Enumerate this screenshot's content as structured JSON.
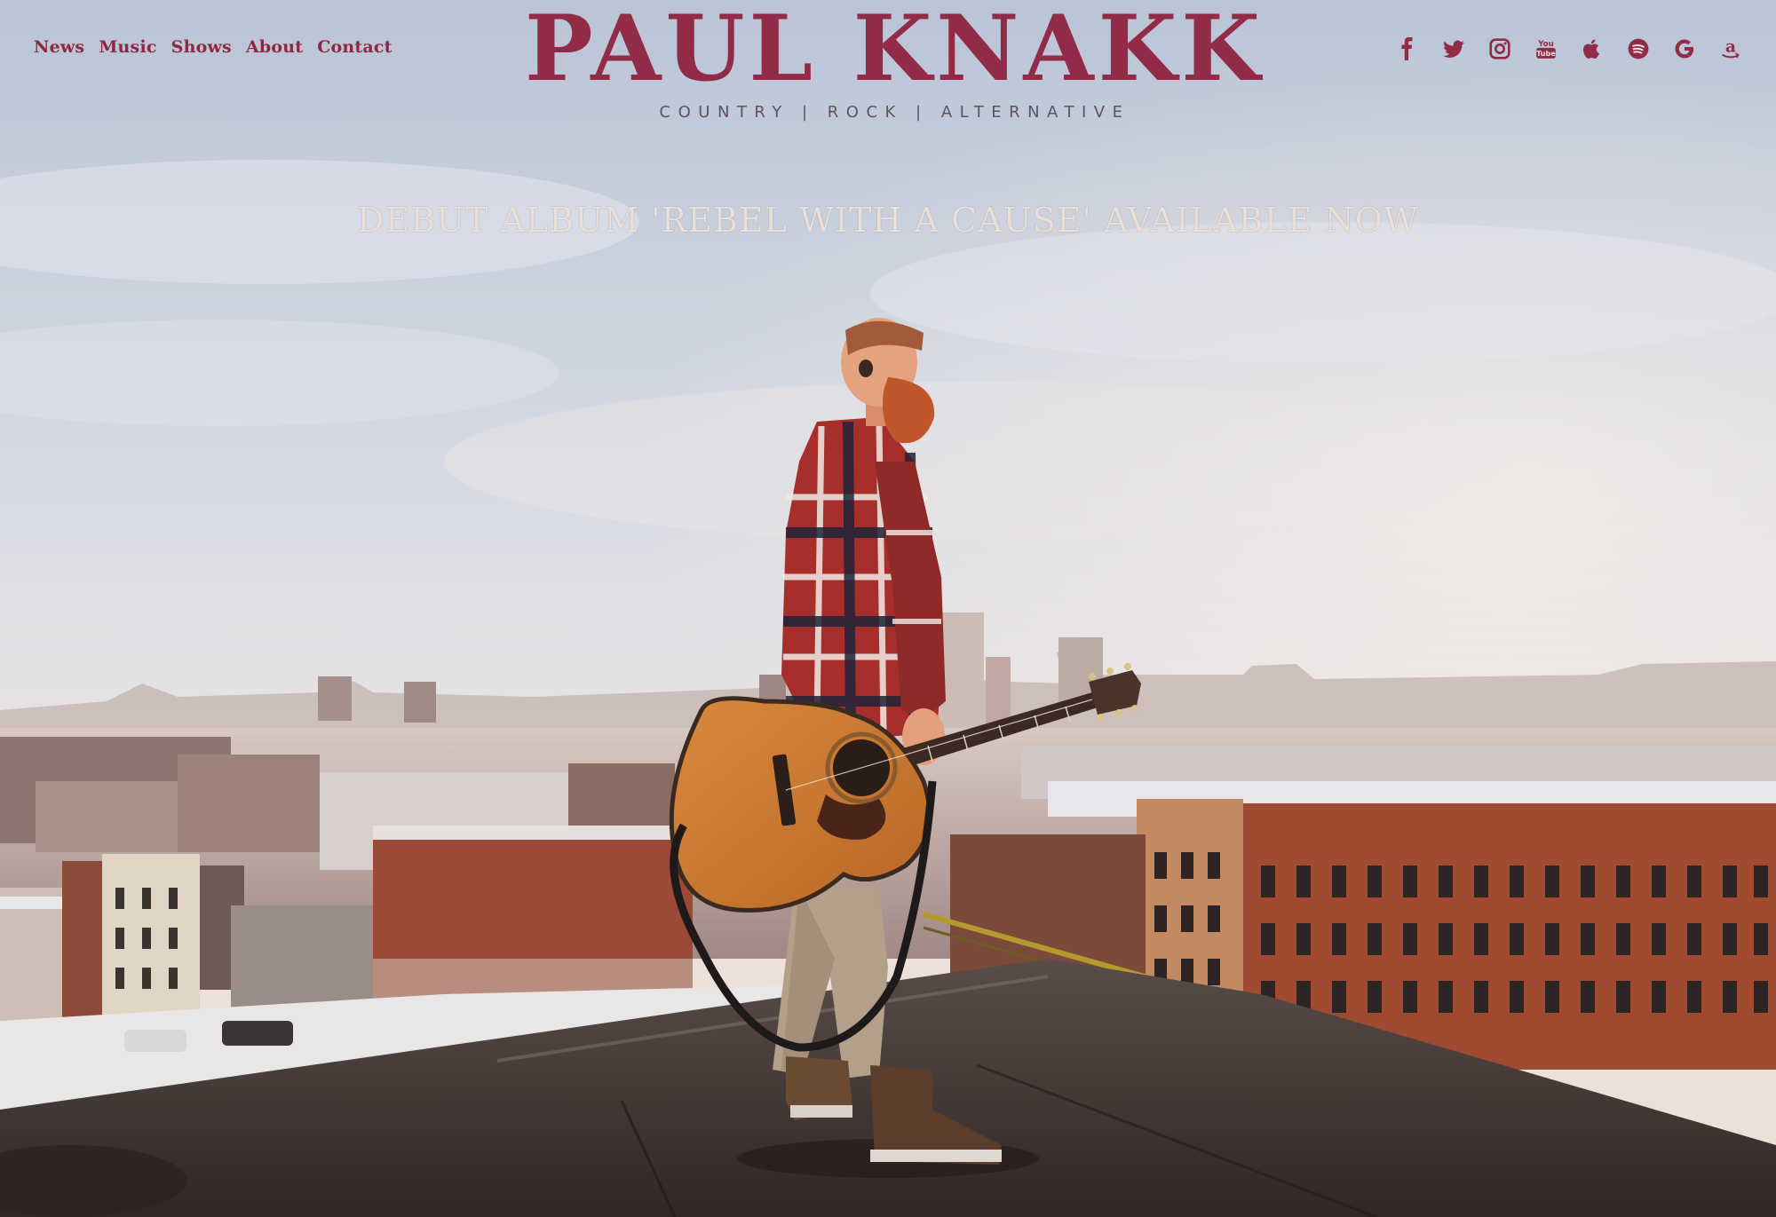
{
  "nav": {
    "items": [
      "News",
      "Music",
      "Shows",
      "About",
      "Contact"
    ]
  },
  "brand": {
    "name": "PAUL KNAKK",
    "tagline": "COUNTRY | ROCK | ALTERNATIVE",
    "color": "#922b47"
  },
  "social": {
    "icons": [
      "facebook-icon",
      "twitter-icon",
      "instagram-icon",
      "youtube-icon",
      "apple-music-icon",
      "spotify-icon",
      "google-play-icon",
      "amazon-icon"
    ],
    "youtube_text": "You Tube"
  },
  "hero": {
    "announcement": "DEBUT ALBUM 'REBEL WITH A CAUSE' AVAILABLE NOW",
    "image_description": "Bearded man in red plaid shirt holding an acoustic guitar on a rooftop overlooking a city"
  }
}
